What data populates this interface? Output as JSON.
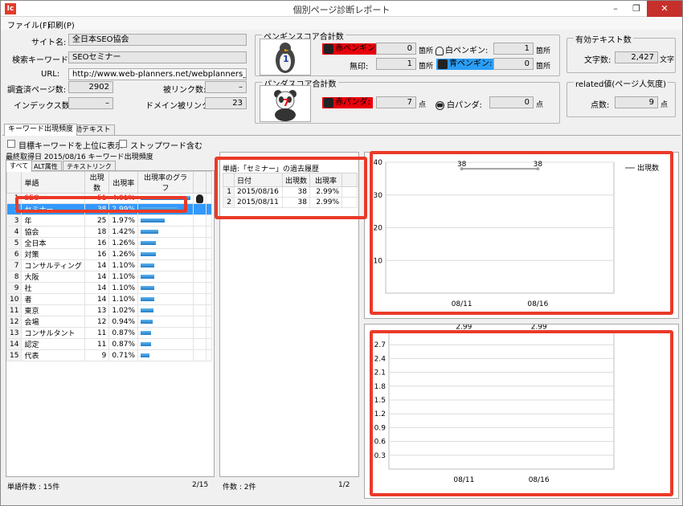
{
  "window": {
    "title": "個別ページ診断レポート",
    "app_icon": "Ic",
    "minimize": "–",
    "maximize": "❐",
    "close": "✕"
  },
  "menu": [
    "ファイル(F)",
    "印刷(P)"
  ],
  "info": {
    "site_name_label": "サイト名:",
    "site_name": "全日本SEO協会",
    "keyword_label": "検索キーワード:",
    "keyword": "SEOセミナー",
    "url_label": "URL:",
    "url": "http://www.web-planners.net/webplanners_consul",
    "surveyed_pages_label": "調査済ページ数:",
    "surveyed_pages": "2902",
    "backlinks_label": "被リンク数:",
    "backlinks": "–",
    "indexed_label": "インデックス数:",
    "indexed": "–",
    "domain_backlinks_label": "ドメイン被リンク:",
    "domain_backlinks": "23"
  },
  "penguin": {
    "title": "ペンギンスコア合計数",
    "mascot_score": "1",
    "red_label": "赤ペンギン:",
    "red_value": "0",
    "red_unit": "箇所",
    "white_label": "白ペンギン:",
    "white_value": "1",
    "white_unit": "箇所",
    "none_label": "無印:",
    "none_value": "1",
    "none_unit": "箇所",
    "blue_label": "青ペンギン:",
    "blue_value": "0",
    "blue_unit": "箇所"
  },
  "panda": {
    "title": "パンダスコア合計数",
    "mascot_score": "7",
    "red_label": "赤パンダ:",
    "red_value": "7",
    "red_unit": "点",
    "white_label": "白パンダ:",
    "white_value": "0",
    "white_unit": "点"
  },
  "text_count": {
    "title": "有効テキスト数",
    "label": "文字数:",
    "value": "2,427",
    "unit": "文字"
  },
  "related": {
    "title": "related値(ページ人気度)",
    "label": "点数:",
    "value": "9",
    "unit": "点"
  },
  "main_tabs": [
    "キーワード出現頻度",
    "有効テキスト"
  ],
  "options": {
    "top_keyword": "目標キーワードを上位に表示",
    "stopword": "ストップワード含む"
  },
  "keyword_table": {
    "caption": "最終取得日 2015/08/16 キーワード出現頻度",
    "tabs": [
      "すべて",
      "ALT属性",
      "テキストリンク"
    ],
    "headers": [
      "単語",
      "出現数",
      "出現率",
      "出現率のグラフ"
    ],
    "rows": [
      {
        "idx": "1",
        "word": "SEO",
        "count": "51",
        "rate": "4.01%",
        "pct": 4.01
      },
      {
        "idx": "2",
        "word": "セミナー",
        "count": "38",
        "rate": "2.99%",
        "pct": 2.99
      },
      {
        "idx": "3",
        "word": "年",
        "count": "25",
        "rate": "1.97%",
        "pct": 1.97
      },
      {
        "idx": "4",
        "word": "協会",
        "count": "18",
        "rate": "1.42%",
        "pct": 1.42
      },
      {
        "idx": "5",
        "word": "全日本",
        "count": "16",
        "rate": "1.26%",
        "pct": 1.26
      },
      {
        "idx": "6",
        "word": "対策",
        "count": "16",
        "rate": "1.26%",
        "pct": 1.26
      },
      {
        "idx": "7",
        "word": "コンサルティング",
        "count": "14",
        "rate": "1.10%",
        "pct": 1.1
      },
      {
        "idx": "8",
        "word": "大阪",
        "count": "14",
        "rate": "1.10%",
        "pct": 1.1
      },
      {
        "idx": "9",
        "word": "社",
        "count": "14",
        "rate": "1.10%",
        "pct": 1.1
      },
      {
        "idx": "10",
        "word": "者",
        "count": "14",
        "rate": "1.10%",
        "pct": 1.1
      },
      {
        "idx": "11",
        "word": "東京",
        "count": "13",
        "rate": "1.02%",
        "pct": 1.02
      },
      {
        "idx": "12",
        "word": "会場",
        "count": "12",
        "rate": "0.94%",
        "pct": 0.94
      },
      {
        "idx": "13",
        "word": "コンサルタント",
        "count": "11",
        "rate": "0.87%",
        "pct": 0.87
      },
      {
        "idx": "14",
        "word": "認定",
        "count": "11",
        "rate": "0.87%",
        "pct": 0.87
      },
      {
        "idx": "15",
        "word": "代表",
        "count": "9",
        "rate": "0.71%",
        "pct": 0.71
      }
    ],
    "status_left": "単語件数 : 15件",
    "status_right": "2/15"
  },
  "history": {
    "title": "単語:「セミナー」の過去履歴",
    "headers": [
      "日付",
      "出現数",
      "出現率"
    ],
    "rows": [
      {
        "idx": "1",
        "date": "2015/08/16",
        "count": "38",
        "rate": "2.99%"
      },
      {
        "idx": "2",
        "date": "2015/08/11",
        "count": "38",
        "rate": "2.99%"
      }
    ],
    "status_left": "件数 : 2件",
    "status_right": "1/2"
  },
  "chart_data": [
    {
      "type": "line",
      "categories": [
        "08/11",
        "08/16"
      ],
      "series": [
        {
          "name": "出現数",
          "values": [
            38,
            38
          ]
        }
      ],
      "data_labels": [
        "38",
        "38"
      ],
      "yticks": [
        "10",
        "20",
        "30",
        "40"
      ],
      "ylim": [
        0,
        40
      ],
      "grid": true,
      "legend": "top-right",
      "line_color": "#a0a0a0"
    },
    {
      "type": "line",
      "categories": [
        "08/11",
        "08/16"
      ],
      "series": [
        {
          "name": "",
          "values": [
            2.99,
            2.99
          ]
        }
      ],
      "data_labels": [
        "2.99",
        "2.99"
      ],
      "yticks": [
        "0.3",
        "0.6",
        "0.9",
        "1.2",
        "1.5",
        "1.8",
        "2.1",
        "2.4",
        "2.7"
      ],
      "ylim": [
        0,
        3.0
      ],
      "grid": true,
      "line_color": "#a0a0a0"
    }
  ]
}
